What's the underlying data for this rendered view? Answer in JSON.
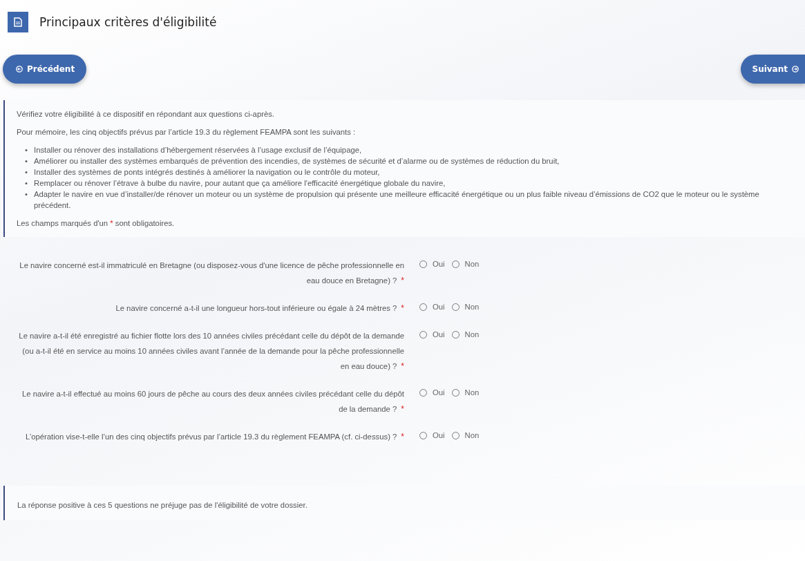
{
  "header": {
    "title": "Principaux critères d'éligibilité"
  },
  "nav": {
    "previous": "Précédent",
    "next": "Suivant"
  },
  "intro": {
    "lead": "Vérifiez votre éligibilité à ce dispositif en répondant aux questions ci-après.",
    "reminder": "Pour mémoire, les cinq objectifs prévus par l’article 19.3 du règlement FEAMPA sont les suivants :",
    "bullet": "•",
    "objectives": [
      "Installer ou rénover des installations d’hébergement réservées à l’usage exclusif de l’équipage,",
      "Améliorer ou installer des systèmes embarqués de prévention des incendies, de systèmes de sécurité et d’alarme ou de systèmes de réduction du bruit,",
      "Installer des systèmes de ponts intégrés destinés à améliorer la navigation ou le contrôle du moteur,",
      "Remplacer ou rénover l’étrave à bulbe du navire, pour autant que ça améliore l'efficacité énergétique globale du navire,",
      "Adapter le navire en vue d’installer/de rénover un moteur ou un système de propulsion qui présente une meilleure efficacité énergétique ou un plus faible niveau d’émissions de CO2 que le moteur ou le système précédent."
    ],
    "required_note": {
      "before": "Les champs marqués d'un",
      "mark": "*",
      "after": "sont obligatoires."
    }
  },
  "questions": [
    {
      "label": "Le navire concerné est-il immatriculé en Bretagne (ou disposez-vous d'une licence de pêche professionnelle en eau douce en Bretagne) ?",
      "required_mark": "*",
      "options": [
        {
          "label": "Oui",
          "selected": false
        },
        {
          "label": "Non",
          "selected": false
        }
      ]
    },
    {
      "label": "Le navire concerné a-t-il une longueur hors-tout inférieure ou égale à 24 mètres ?",
      "required_mark": "*",
      "options": [
        {
          "label": "Oui",
          "selected": false
        },
        {
          "label": "Non",
          "selected": false
        }
      ]
    },
    {
      "label": "Le navire a-t-il été enregistré au fichier flotte lors des 10 années civiles précédant celle du dépôt de la demande (ou a-t-il été en service au moins 10 années civiles avant l’année de la demande pour la pêche professionnelle en eau douce) ?",
      "required_mark": "*",
      "options": [
        {
          "label": "Oui",
          "selected": false
        },
        {
          "label": "Non",
          "selected": false
        }
      ]
    },
    {
      "label": "Le navire a-t-il effectué au moins 60 jours de pêche au cours des deux années civiles précédant celle du dépôt de la demande ?",
      "required_mark": "*",
      "options": [
        {
          "label": "Oui",
          "selected": false
        },
        {
          "label": "Non",
          "selected": false
        }
      ]
    },
    {
      "label": "L’opération vise-t-elle l’un des cinq objectifs prévus par l’article 19.3 du règlement FEAMPA (cf. ci-dessus) ?",
      "required_mark": "*",
      "options": [
        {
          "label": "Oui",
          "selected": false
        },
        {
          "label": "Non",
          "selected": false
        }
      ]
    }
  ],
  "footer_note": "La réponse positive à ces 5 questions ne préjuge pas de l'éligibilité de votre dossier."
}
